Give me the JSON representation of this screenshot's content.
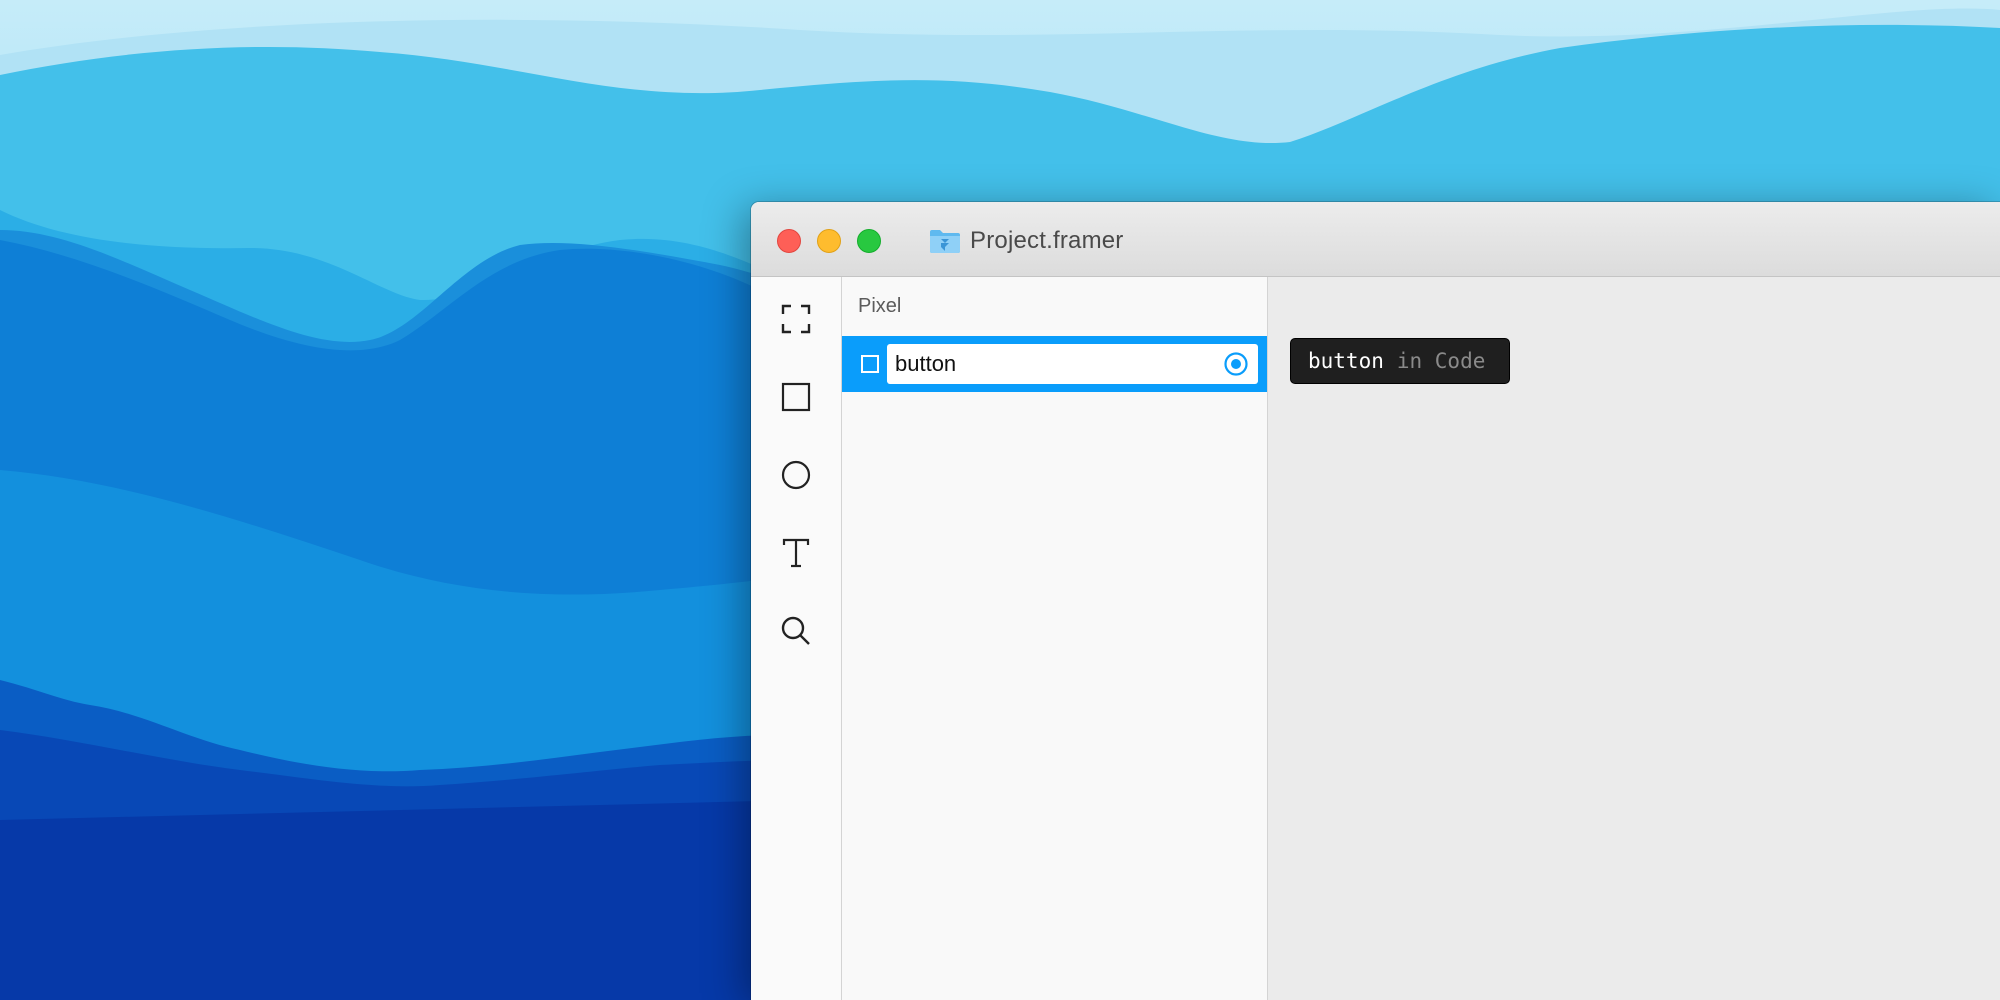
{
  "window": {
    "title": "Project.framer"
  },
  "toolbar": {
    "tools": [
      {
        "name": "frame-tool",
        "icon": "frame-corners-icon"
      },
      {
        "name": "rectangle-tool",
        "icon": "rectangle-icon"
      },
      {
        "name": "oval-tool",
        "icon": "circle-icon"
      },
      {
        "name": "text-tool",
        "icon": "text-t-icon"
      },
      {
        "name": "search-tool",
        "icon": "magnifier-icon"
      }
    ]
  },
  "layers": {
    "title": "Pixel",
    "selected_layer": {
      "name": "button",
      "selected": true
    }
  },
  "canvas": {
    "code_tag": {
      "layer_name": "button",
      "suffix": "in Code"
    }
  },
  "colors": {
    "selection_blue": "#0a9dfb",
    "close": "#fe5f57",
    "minimize": "#febc2e",
    "zoom": "#28c840",
    "tag_background": "#1f1f1f"
  }
}
